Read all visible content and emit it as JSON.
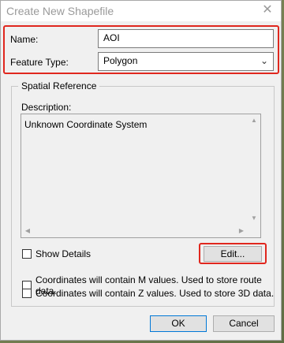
{
  "dialog": {
    "title": "Create New Shapefile",
    "close_glyph": "✕"
  },
  "form": {
    "name_label": "Name:",
    "name_value": "AOI",
    "feature_type_label": "Feature Type:",
    "feature_type_value": "Polygon"
  },
  "spatial_reference": {
    "group_title": "Spatial Reference",
    "description_label": "Description:",
    "description_text": "Unknown Coordinate System",
    "show_details_label": "Show Details",
    "edit_label": "Edit..."
  },
  "options": {
    "m_values_label": "Coordinates will contain M values. Used to store route data.",
    "z_values_label": "Coordinates will contain Z values. Used to store 3D data."
  },
  "footer": {
    "ok_label": "OK",
    "cancel_label": "Cancel"
  },
  "colors": {
    "highlight": "#e0271e",
    "default_button_border": "#0078d7"
  }
}
